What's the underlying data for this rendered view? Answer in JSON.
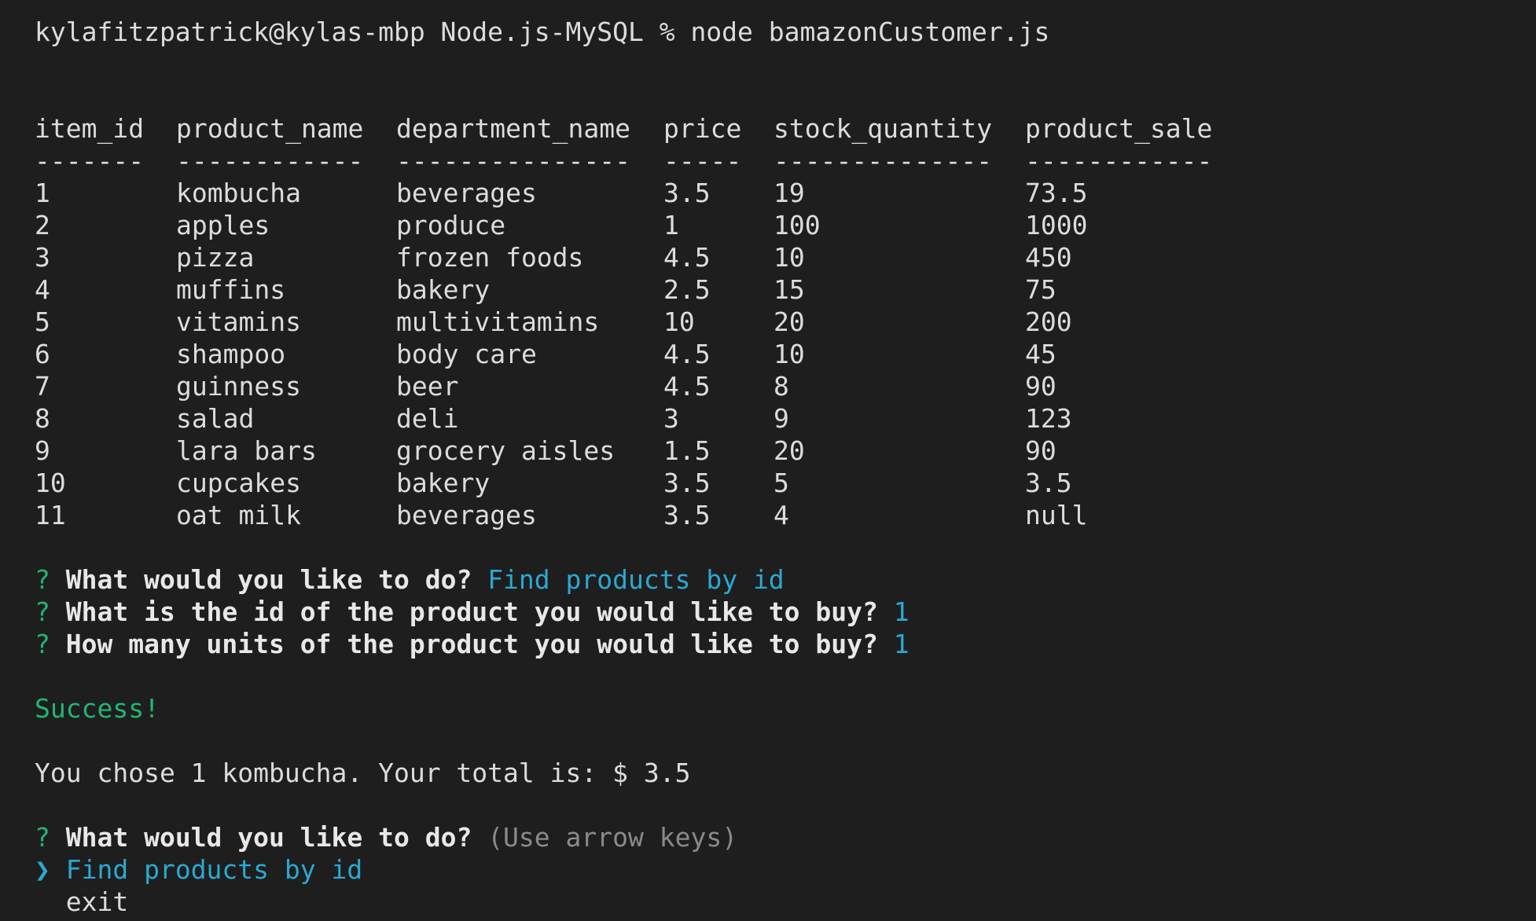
{
  "command_line": "kylafitzpatrick@kylas-mbp Node.js-MySQL % node bamazonCustomer.js",
  "table": {
    "headers": [
      "item_id",
      "product_name",
      "department_name",
      "price",
      "stock_quantity",
      "product_sale"
    ],
    "separators": [
      "-------",
      "------------",
      "---------------",
      "-----",
      "--------------",
      "------------"
    ],
    "rows": [
      [
        "1",
        "kombucha",
        "beverages",
        "3.5",
        "19",
        "73.5"
      ],
      [
        "2",
        "apples",
        "produce",
        "1",
        "100",
        "1000"
      ],
      [
        "3",
        "pizza",
        "frozen foods",
        "4.5",
        "10",
        "450"
      ],
      [
        "4",
        "muffins",
        "bakery",
        "2.5",
        "15",
        "75"
      ],
      [
        "5",
        "vitamins",
        "multivitamins",
        "10",
        "20",
        "200"
      ],
      [
        "6",
        "shampoo",
        "body care",
        "4.5",
        "10",
        "45"
      ],
      [
        "7",
        "guinness",
        "beer",
        "4.5",
        "8",
        "90"
      ],
      [
        "8",
        "salad",
        "deli",
        "3",
        "9",
        "123"
      ],
      [
        "9",
        "lara bars",
        "grocery aisles",
        "1.5",
        "20",
        "90"
      ],
      [
        "10",
        "cupcakes",
        "bakery",
        "3.5",
        "5",
        "3.5"
      ],
      [
        "11",
        "oat milk",
        "beverages",
        "3.5",
        "4",
        "null"
      ]
    ]
  },
  "prompts": [
    {
      "mark": "?",
      "question": "What would you like to do?",
      "answer": "Find products by id"
    },
    {
      "mark": "?",
      "question": "What is the id of the product you would like to buy?",
      "answer": "1"
    },
    {
      "mark": "?",
      "question": "How many units of the product you would like to buy?",
      "answer": "1"
    }
  ],
  "success": "Success!",
  "result": "You chose 1 kombucha. Your total is: $ 3.5",
  "menu_prompt": {
    "mark": "?",
    "question": "What would you like to do?",
    "hint": "(Use arrow keys)"
  },
  "menu": {
    "pointer": "❯",
    "selected": "Find products by id",
    "other": "exit"
  },
  "colors": {
    "background": "#1e1e1e",
    "text": "#dcdcdc",
    "prompt_mark": "#22b573",
    "answer": "#2aa9d2",
    "hint": "#8a8a8a"
  }
}
